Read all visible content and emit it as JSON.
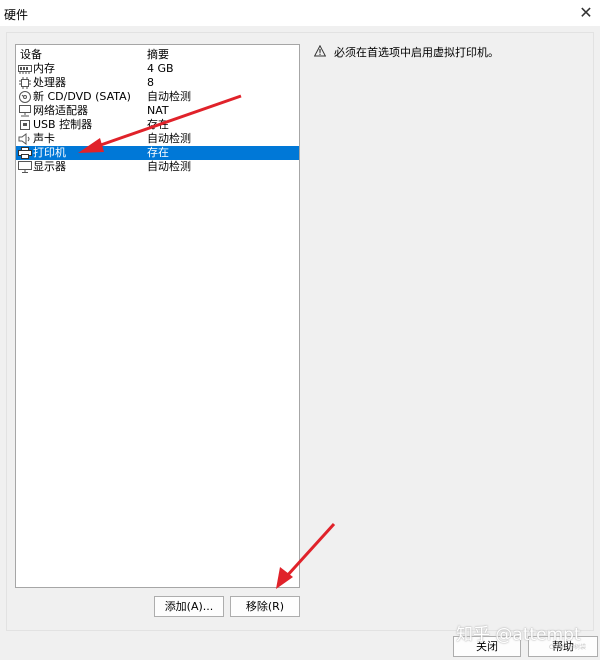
{
  "window": {
    "title": "硬件",
    "close_glyph": "✕"
  },
  "device_list": {
    "headers": {
      "device": "设备",
      "summary": "摘要"
    },
    "rows": [
      {
        "device": "内存",
        "summary": "4 GB",
        "icon": "memory-icon"
      },
      {
        "device": "处理器",
        "summary": "8",
        "icon": "cpu-icon"
      },
      {
        "device": "新 CD/DVD (SATA)",
        "summary": "自动检测",
        "icon": "cd-icon"
      },
      {
        "device": "网络适配器",
        "summary": "NAT",
        "icon": "network-icon"
      },
      {
        "device": "USB 控制器",
        "summary": "存在",
        "icon": "usb-icon"
      },
      {
        "device": "声卡",
        "summary": "自动检测",
        "icon": "speaker-icon"
      },
      {
        "device": "打印机",
        "summary": "存在",
        "icon": "printer-icon",
        "selected": true
      },
      {
        "device": "显示器",
        "summary": "自动检测",
        "icon": "monitor-icon"
      }
    ]
  },
  "buttons": {
    "add": "添加(A)...",
    "remove": "移除(R)",
    "close": "关闭",
    "help": "帮助"
  },
  "warning": {
    "text": "必须在首选项中启用虚拟打印机。",
    "icon": "warning-icon"
  },
  "watermark": {
    "text": "知乎 @attempt",
    "small": "CSDN @树袋"
  },
  "colors": {
    "selection": "#0078d7",
    "annotation_arrow": "#e0222a"
  }
}
